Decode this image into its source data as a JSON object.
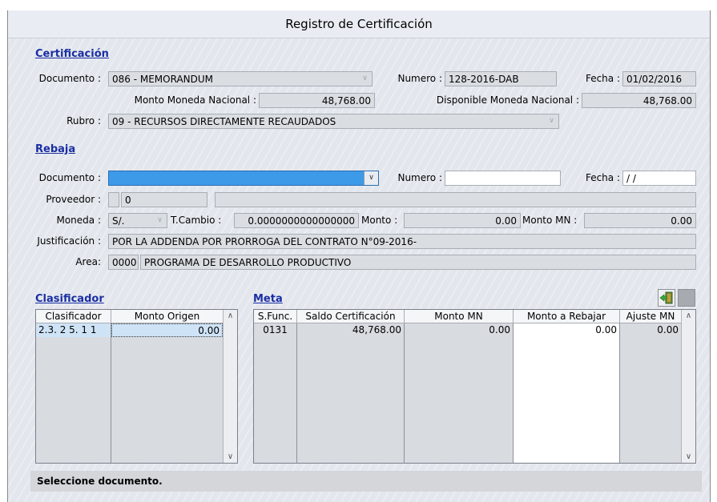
{
  "window": {
    "title": "Registro de Certificación"
  },
  "certificacion": {
    "section": "Certificación",
    "documento_label": "Documento :",
    "documento_value": "086 - MEMORANDUM",
    "numero_label": "Numero :",
    "numero_value": "128-2016-DAB",
    "fecha_label": "Fecha :",
    "fecha_value": "01/02/2016",
    "monto_label": "Monto Moneda Nacional :",
    "monto_value": "48,768.00",
    "disponible_label": "Disponible Moneda Nacional :",
    "disponible_value": "48,768.00",
    "rubro_label": "Rubro :",
    "rubro_value": "09 - RECURSOS DIRECTAMENTE RECAUDADOS"
  },
  "rebaja": {
    "section": "Rebaja",
    "documento_label": "Documento :",
    "documento_value": "",
    "numero_label": "Numero :",
    "numero_value": "",
    "fecha_label": "Fecha :",
    "fecha_value": " / /",
    "proveedor_label": "Proveedor :",
    "proveedor_code": "0",
    "proveedor_name": "",
    "moneda_label": "Moneda :",
    "moneda_value": "S/.",
    "tcambio_label": "T.Cambio :",
    "tcambio_value": "0.0000000000000000",
    "monto_label": "Monto :",
    "monto_value": "0.00",
    "montomn_label": "Monto MN :",
    "montomn_value": "0.00",
    "justificacion_label": "Justificación :",
    "justificacion_value": "POR LA ADDENDA POR PRORROGA DEL CONTRATO N°09-2016-",
    "area_label": "Area:",
    "area_code": "0000",
    "area_name": "PROGRAMA DE DESARROLLO PRODUCTIVO"
  },
  "clasificador": {
    "section": "Clasificador",
    "columns": [
      "Clasificador",
      "Monto Origen"
    ],
    "rows": [
      {
        "clasificador": "2.3. 2 5. 1 1",
        "monto": "0.00"
      }
    ]
  },
  "meta": {
    "section": "Meta",
    "columns": [
      "S.Func.",
      "Saldo Certificación",
      "Monto MN",
      "Monto a Rebajar",
      "Ajuste MN"
    ],
    "rows": [
      {
        "sfunc": "0131",
        "saldo": "48,768.00",
        "montomn": "0.00",
        "rebajar": "0.00",
        "ajuste": "0.00"
      }
    ]
  },
  "status": {
    "message": "Seleccione documento."
  },
  "icons": {
    "exit": "exit-door-icon",
    "stop": "square-icon"
  },
  "colors": {
    "section_title": "#1a2ea3",
    "selected_field": "#3d9ae8",
    "window_bg": "#e3e7ed"
  }
}
